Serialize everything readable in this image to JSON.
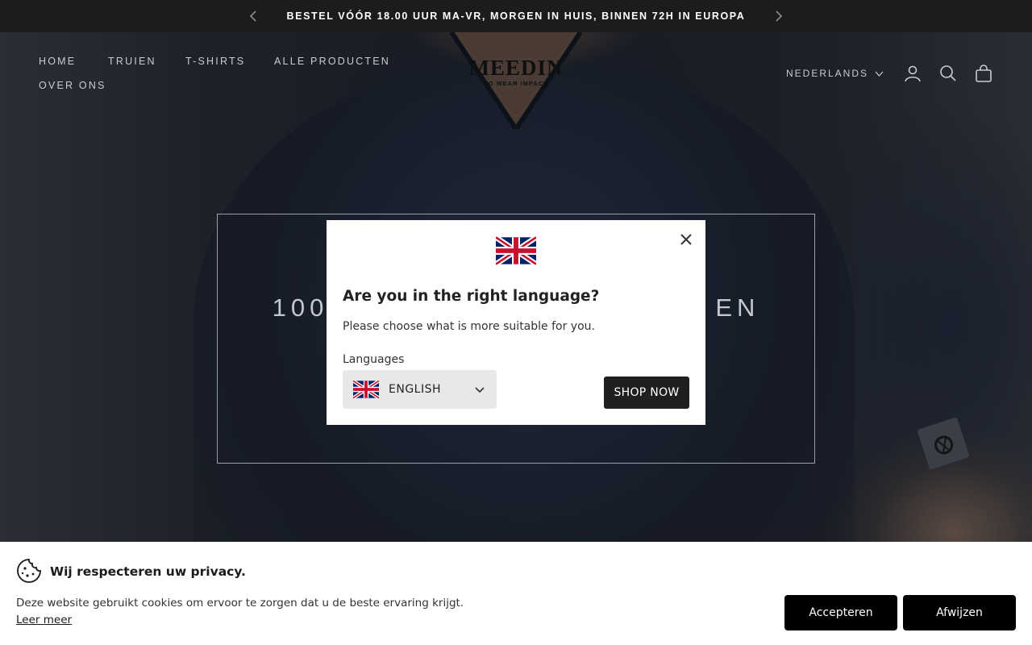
{
  "announcement": {
    "text": "BESTEL VÓÓR 18.00 UUR MA-VR, MORGEN IN HUIS, BINNEN 72H IN EUROPA",
    "prev_icon": "chevron-left-icon",
    "next_icon": "chevron-right-icon"
  },
  "header": {
    "nav": [
      "HOME",
      "TRUIEN",
      "T-SHIRTS",
      "ALLE PRODUCTEN",
      "OVER ONS"
    ],
    "logo": {
      "mark": "MEEDIN",
      "sub": "TO WEAR IMPACT"
    },
    "language": "NEDERLANDS",
    "icons": [
      "account-icon",
      "search-icon",
      "cart-icon"
    ]
  },
  "hero": {
    "title": "100% ECOLOGISCHE MERINO TRUIEN",
    "visible_title_left": "100",
    "visible_title_right": "EN"
  },
  "language_modal": {
    "title": "Are you in the right language?",
    "description": "Please choose what is more suitable for you.",
    "languages_label": "Languages",
    "selected_language": "ENGLISH",
    "button": "SHOP NOW",
    "flag_icon": "uk-flag-icon",
    "close_icon": "close-icon"
  },
  "cookie_banner": {
    "title": "Wij respecteren uw privacy.",
    "description": "Deze website gebruikt cookies om ervoor te zorgen dat u de beste ervaring krijgt.",
    "learn_more": "Leer meer",
    "accept": "Accepteren",
    "reject": "Afwijzen",
    "icon": "cookie-icon"
  },
  "colors": {
    "announcement_bg": "#1c1c1c",
    "modal_bg": "#ffffff",
    "button_dark": "#1f1f1f",
    "cookie_button": "#000000"
  }
}
